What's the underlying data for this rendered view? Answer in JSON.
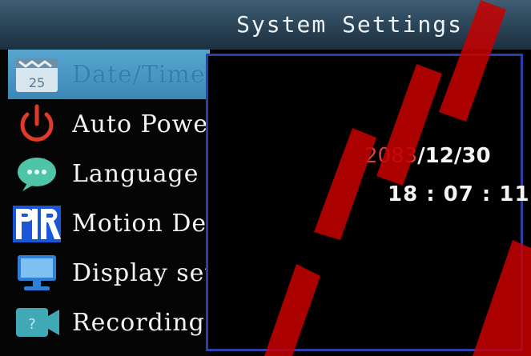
{
  "title": "System Settings",
  "menu": {
    "items": [
      {
        "label": "Date/Time",
        "icon": "calendar-icon",
        "selected": true
      },
      {
        "label": "Auto Power",
        "icon": "power-icon",
        "selected": false
      },
      {
        "label": "Language",
        "icon": "speech-bubble-icon",
        "selected": false
      },
      {
        "label": "Motion Detect",
        "icon": "pir-icon",
        "selected": false
      },
      {
        "label": "Display setting",
        "icon": "monitor-icon",
        "selected": false
      },
      {
        "label": "Recording",
        "icon": "recording-icon",
        "selected": false
      }
    ],
    "calendar_day": "25"
  },
  "datetime": {
    "year": "2083",
    "sep1": "/",
    "month": "12",
    "sep2": "/",
    "day": "30",
    "time": "18 : 07 : 11"
  },
  "colors": {
    "title_bar": "#2a4356",
    "selected_item": "#4a9ac6",
    "panel_border": "#2a3fa8",
    "year_highlight": "#e03a3a"
  }
}
